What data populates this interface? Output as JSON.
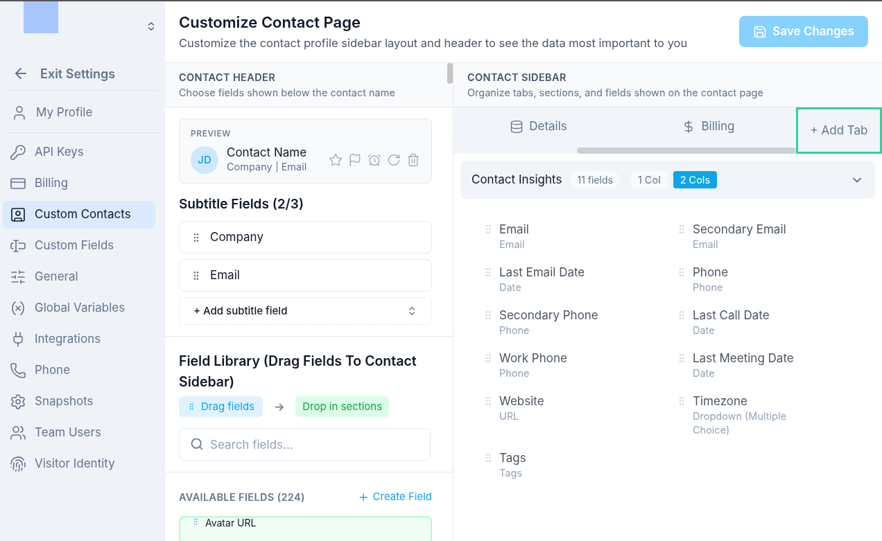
{
  "sidebar": {
    "exit": {
      "label": "Exit Settings"
    },
    "profile": {
      "label": "My Profile",
      "selected": false
    },
    "items": [
      {
        "label": "API Keys",
        "kind": "key",
        "selected": false
      },
      {
        "label": "Billing",
        "kind": "card",
        "selected": false
      },
      {
        "label": "Custom Contacts",
        "kind": "contact",
        "selected": true
      },
      {
        "label": "Custom Fields",
        "kind": "field",
        "selected": false
      },
      {
        "label": "General",
        "kind": "sliders",
        "selected": false
      },
      {
        "label": "Global Variables",
        "kind": "variable",
        "selected": false
      },
      {
        "label": "Integrations",
        "kind": "plug",
        "selected": false
      },
      {
        "label": "Phone",
        "kind": "phone",
        "selected": false
      },
      {
        "label": "Snapshots",
        "kind": "gear",
        "selected": false
      },
      {
        "label": "Team Users",
        "kind": "users",
        "selected": false
      },
      {
        "label": "Visitor Identity",
        "kind": "fingerprint",
        "selected": false
      }
    ]
  },
  "header": {
    "title": "Customize Contact Page",
    "subtitle": "Customize the contact profile sidebar layout and header to see the data most important to you",
    "save_button": {
      "label": "Save Changes",
      "disabled": true
    }
  },
  "contact_header": {
    "title": "CONTACT HEADER",
    "subtitle": "Choose fields shown below the contact name",
    "preview": {
      "label": "PREVIEW",
      "initials": "JD",
      "name": "Contact Name",
      "company": "Company",
      "email": "Email"
    },
    "subtitle_fields": {
      "title": "Subtitle Fields (2/3)",
      "items": [
        "Company",
        "Email"
      ],
      "add_label": "+ Add subtitle field"
    },
    "library": {
      "title": "Field Library (Drag Fields To Contact Sidebar)",
      "drag_label": "Drag fields",
      "arrow": "→",
      "drop_label": "Drop in sections",
      "search_placeholder": "Search fields...",
      "available_title": "AVAILABLE FIELDS (224)",
      "create_label": "Create Field",
      "fields": [
        "Avatar URL"
      ]
    }
  },
  "contact_sidebar": {
    "title": "CONTACT SIDEBAR",
    "subtitle": "Organize tabs, sections, and fields shown on the contact page",
    "tabs": [
      {
        "label": "Details",
        "kind": "database",
        "selected": false
      },
      {
        "label": "Billing",
        "kind": "dollar",
        "selected": false
      }
    ],
    "add_tab": {
      "label": "+ Add Tab",
      "highlighted": true
    },
    "section": {
      "title": "Contact Insights",
      "count": "11 fields",
      "expanded": true,
      "layouts": [
        {
          "label": "1 Col",
          "selected": false
        },
        {
          "label": "2 Cols",
          "selected": true
        }
      ],
      "fields": [
        {
          "name": "Email",
          "type": "Email"
        },
        {
          "name": "Secondary Email",
          "type": "Email"
        },
        {
          "name": "Last Email Date",
          "type": "Date"
        },
        {
          "name": "Phone",
          "type": "Phone"
        },
        {
          "name": "Secondary Phone",
          "type": "Phone"
        },
        {
          "name": "Last Call Date",
          "type": "Date"
        },
        {
          "name": "Work Phone",
          "type": "Phone"
        },
        {
          "name": "Last Meeting Date",
          "type": "Date"
        },
        {
          "name": "Website",
          "type": "URL"
        },
        {
          "name": "Timezone",
          "type": "Dropdown (Multiple Choice)"
        },
        {
          "name": "Tags",
          "type": "Tags"
        }
      ]
    }
  }
}
